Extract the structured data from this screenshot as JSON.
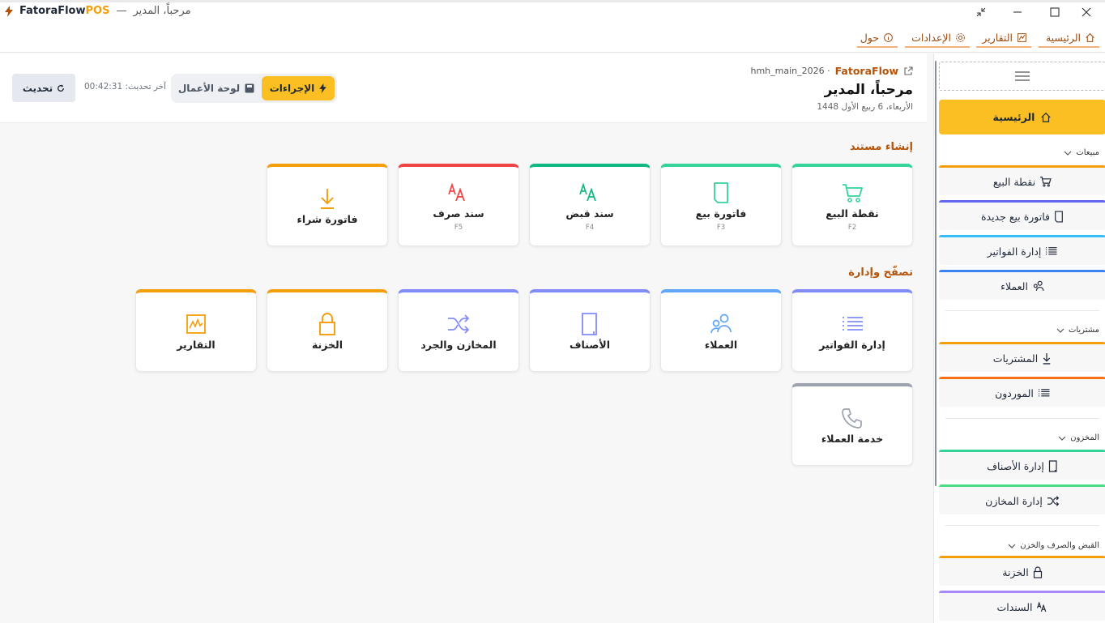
{
  "window": {
    "app_name": "FatoraFlow",
    "app_suffix": "POS",
    "separator": "—",
    "subtitle": "مرحباً، المدير"
  },
  "menu": {
    "home": "الرئيسية",
    "reports": "التقارير",
    "settings": "الإعدادات",
    "about": "حول"
  },
  "header": {
    "brand": "FatoraFlow",
    "db": "hmh_main_2026 ·",
    "welcome": "مرحباً، المدير",
    "date": "الأربعاء، 6 ربيع الأول 1448",
    "actions_tab": "الإجراءات",
    "dashboard_tab": "لوحة الأعمال",
    "last_update_label": "آخر تحديث:",
    "last_update_time": "00:42:31",
    "refresh": "تحديث"
  },
  "sections": {
    "create": "إنشاء مستند",
    "browse": "تصفّح وإدارة"
  },
  "create_cards": [
    {
      "label": "نقطة البيع",
      "key": "F2",
      "icon": "cart-icon",
      "color": "#34d399"
    },
    {
      "label": "فاتورة بيع",
      "key": "F3",
      "icon": "document-icon",
      "color": "#34d399"
    },
    {
      "label": "سند قبض",
      "key": "F4",
      "icon": "font-icon",
      "color": "#10b981"
    },
    {
      "label": "سند صرف",
      "key": "F5",
      "icon": "font-icon",
      "color": "#ef4444"
    },
    {
      "label": "فاتورة شراء",
      "key": "",
      "icon": "download-icon",
      "color": "#f59e0b"
    }
  ],
  "browse_cards": [
    {
      "label": "إدارة الفواتير",
      "icon": "list-icon",
      "color": "#818cf8"
    },
    {
      "label": "العملاء",
      "icon": "people-icon",
      "color": "#60a5fa"
    },
    {
      "label": "الأصناف",
      "icon": "item-icon",
      "color": "#818cf8"
    },
    {
      "label": "المخازن والجرد",
      "icon": "shuffle-icon",
      "color": "#818cf8"
    },
    {
      "label": "الخزنة",
      "icon": "lock-icon",
      "color": "#f59e0b"
    },
    {
      "label": "التقارير",
      "icon": "chart-icon",
      "color": "#f59e0b"
    },
    {
      "label": "خدمة العملاء",
      "icon": "phone-icon",
      "color": "#9ca3af"
    }
  ],
  "sidebar": {
    "home": "الرئيسية",
    "groups": {
      "sales": "مبيعات",
      "purchases": "مشتريات",
      "inventory": "المخزون",
      "cash": "القبض والصرف والخزن"
    },
    "items": [
      {
        "label": "نقطة البيع",
        "icon": "cart-icon",
        "color": "#f59e0b"
      },
      {
        "label": "فاتورة بيع جديدة",
        "icon": "document-icon",
        "color": "#6366f1"
      },
      {
        "label": "إدارة الفواتير",
        "icon": "list-icon",
        "color": "#38bdf8"
      },
      {
        "label": "العملاء",
        "icon": "people-icon",
        "color": "#3b82f6"
      },
      {
        "label": "المشتريات",
        "icon": "download-icon",
        "color": "#f59e0b"
      },
      {
        "label": "الموردون",
        "icon": "list-icon",
        "color": "#f97316"
      },
      {
        "label": "إدارة الأصناف",
        "icon": "item-icon",
        "color": "#34d399"
      },
      {
        "label": "إدارة المخازن",
        "icon": "shuffle-icon",
        "color": "#4ade80"
      },
      {
        "label": "الخزنة",
        "icon": "lock-icon",
        "color": "#f59e0b"
      },
      {
        "label": "السندات",
        "icon": "font-icon",
        "color": "#a78bfa"
      }
    ]
  }
}
